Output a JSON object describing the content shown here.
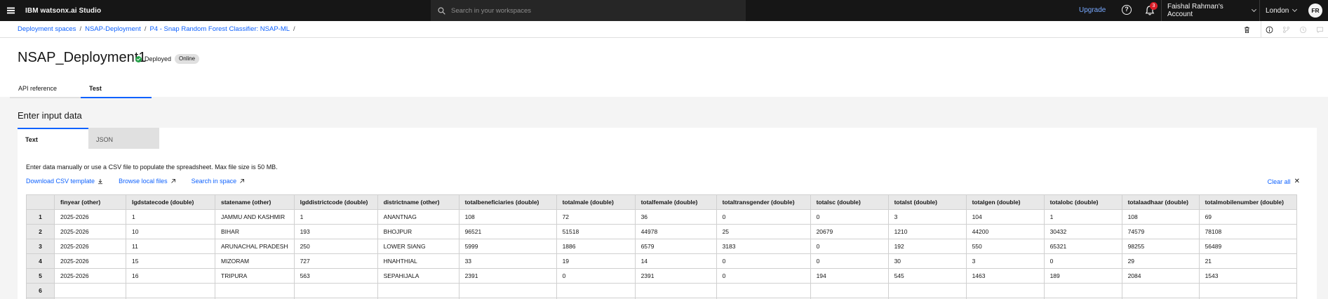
{
  "header": {
    "brand": "IBM watsonx.ai Studio",
    "search_placeholder": "Search in your workspaces",
    "upgrade": "Upgrade",
    "help": "?",
    "notification_count": "3",
    "account": "Faishal Rahman's Account",
    "region": "London",
    "avatar_initials": "FR"
  },
  "breadcrumb": {
    "items": [
      "Deployment spaces",
      "NSAP-Deployment",
      "P4 - Snap Random Forest Classifier: NSAP-ML"
    ],
    "separator": "/"
  },
  "page": {
    "title": "NSAP_Deployment1",
    "status": "Deployed",
    "tag": "Online",
    "tabs": [
      "API reference",
      "Test"
    ]
  },
  "input": {
    "section_title": "Enter input data",
    "tabs": [
      "Text",
      "JSON"
    ],
    "instructions": "Enter data manually or use a CSV file to populate the spreadsheet. Max file size is 50 MB.",
    "download_link": "Download CSV template",
    "browse_link": "Browse local files",
    "search_link": "Search in space",
    "clear_all": "Clear all"
  },
  "table": {
    "columns": [
      "finyear (other)",
      "lgdstatecode (double)",
      "statename (other)",
      "lgddistrictcode (double)",
      "districtname (other)",
      "totalbeneficiaries (double)",
      "totalmale (double)",
      "totalfemale (double)",
      "totaltransgender (double)",
      "totalsc (double)",
      "totalst (double)",
      "totalgen (double)",
      "totalobc (double)",
      "totalaadhaar (double)",
      "totalmobilenumber (double)"
    ],
    "rows": [
      {
        "n": "1",
        "cells": [
          "2025-2026",
          "1",
          "JAMMU AND KASHMIR",
          "1",
          "ANANTNAG",
          "108",
          "72",
          "36",
          "0",
          "0",
          "3",
          "104",
          "1",
          "108",
          "69"
        ]
      },
      {
        "n": "2",
        "cells": [
          "2025-2026",
          "10",
          "BIHAR",
          "193",
          "BHOJPUR",
          "96521",
          "51518",
          "44978",
          "25",
          "20679",
          "1210",
          "44200",
          "30432",
          "74579",
          "78108"
        ]
      },
      {
        "n": "3",
        "cells": [
          "2025-2026",
          "11",
          "ARUNACHAL PRADESH",
          "250",
          "LOWER SIANG",
          "5999",
          "1886",
          "6579",
          "3183",
          "0",
          "192",
          "550",
          "65321",
          "98255",
          "56489"
        ]
      },
      {
        "n": "4",
        "cells": [
          "2025-2026",
          "15",
          "MIZORAM",
          "727",
          "HNAHTHIAL",
          "33",
          "19",
          "14",
          "0",
          "0",
          "30",
          "3",
          "0",
          "29",
          "21"
        ]
      },
      {
        "n": "5",
        "cells": [
          "2025-2026",
          "16",
          "TRIPURA",
          "563",
          "SEPAHIJALA",
          "2391",
          "0",
          "2391",
          "0",
          "194",
          "545",
          "1463",
          "189",
          "2084",
          "1543"
        ]
      },
      {
        "n": "6",
        "cells": [
          "",
          "",
          "",
          "",
          "",
          "",
          "",
          "",
          "",
          "",
          "",
          "",
          "",
          "",
          ""
        ]
      },
      {
        "n": "",
        "cells": [
          "",
          "",
          "",
          "",
          "",
          "",
          "",
          "",
          "",
          "",
          "",
          "",
          "",
          "",
          ""
        ]
      }
    ]
  }
}
